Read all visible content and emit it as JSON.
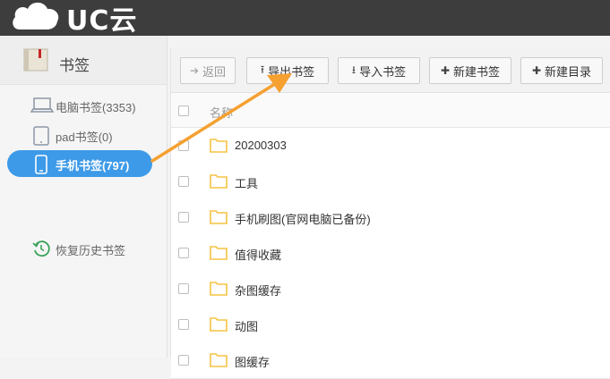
{
  "app": {
    "logo_text": "UC云"
  },
  "sidebar": {
    "header_title": "书签",
    "items": [
      {
        "label": "电脑书签(3353)",
        "icon": "laptop-icon",
        "active": false
      },
      {
        "label": "pad书签(0)",
        "icon": "tablet-icon",
        "active": false
      },
      {
        "label": "手机书签(797)",
        "icon": "phone-icon",
        "active": true
      }
    ],
    "restore_label": "恢复历史书签"
  },
  "toolbar": {
    "back_label": "返回",
    "export_label": "导出书签",
    "import_label": "导入书签",
    "new_bookmark_label": "新建书签",
    "new_folder_label": "新建目录"
  },
  "table": {
    "header_label": "名称",
    "rows": [
      "20200303",
      "工具",
      "手机刷图(官网电脑已备份)",
      "值得收藏",
      "杂图缓存",
      "动图",
      "图缓存"
    ]
  },
  "colors": {
    "topbar": "#3d3d3d",
    "active_nav": "#3d9ae8",
    "folder": "#f5c342",
    "annotation_arrow": "#f5a030"
  }
}
